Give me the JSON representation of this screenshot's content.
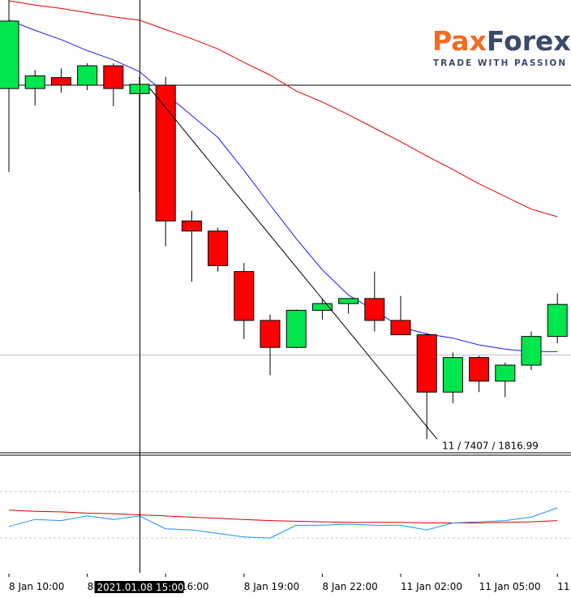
{
  "brand": {
    "name_part1": "Pa",
    "name_part2": "Forex",
    "tagline": "TRADE WITH PASSION",
    "colors": {
      "orange": "#f26b21",
      "navy": "#3b4a6b"
    }
  },
  "chart_data": {
    "type": "candlestick",
    "price_range": [
      1815.5,
      1869
    ],
    "bull_color": "#00e64d",
    "bear_color": "#ff0000",
    "candles": [
      {
        "o": 1858.5,
        "h": 1869.0,
        "l": 1848.6,
        "c": 1866.5
      },
      {
        "o": 1858.5,
        "h": 1860.7,
        "l": 1856.5,
        "c": 1860.0
      },
      {
        "o": 1859.8,
        "h": 1860.9,
        "l": 1858.0,
        "c": 1858.9
      },
      {
        "o": 1858.9,
        "h": 1861.5,
        "l": 1858.3,
        "c": 1861.2
      },
      {
        "o": 1861.2,
        "h": 1861.5,
        "l": 1856.4,
        "c": 1858.5
      },
      {
        "o": 1857.9,
        "h": 1859.9,
        "l": 1846.2,
        "c": 1859.0
      },
      {
        "o": 1858.9,
        "h": 1859.9,
        "l": 1839.8,
        "c": 1842.8
      },
      {
        "o": 1842.8,
        "h": 1844.0,
        "l": 1835.6,
        "c": 1841.6
      },
      {
        "o": 1841.6,
        "h": 1842.0,
        "l": 1836.8,
        "c": 1837.5
      },
      {
        "o": 1836.8,
        "h": 1837.8,
        "l": 1828.8,
        "c": 1831.0
      },
      {
        "o": 1831.0,
        "h": 1831.7,
        "l": 1824.5,
        "c": 1827.8
      },
      {
        "o": 1827.8,
        "h": 1832.3,
        "l": 1827.7,
        "c": 1832.2
      },
      {
        "o": 1832.2,
        "h": 1833.6,
        "l": 1831.1,
        "c": 1833.0
      },
      {
        "o": 1833.0,
        "h": 1833.6,
        "l": 1831.8,
        "c": 1833.6
      },
      {
        "o": 1833.6,
        "h": 1836.8,
        "l": 1829.7,
        "c": 1831.0
      },
      {
        "o": 1831.0,
        "h": 1833.9,
        "l": 1829.9,
        "c": 1829.3
      },
      {
        "o": 1829.3,
        "h": 1829.5,
        "l": 1816.9,
        "c": 1822.5
      },
      {
        "o": 1822.5,
        "h": 1827.2,
        "l": 1821.2,
        "c": 1826.6
      },
      {
        "o": 1826.6,
        "h": 1826.8,
        "l": 1822.5,
        "c": 1823.8
      },
      {
        "o": 1823.8,
        "h": 1826.0,
        "l": 1821.9,
        "c": 1825.7
      },
      {
        "o": 1825.7,
        "h": 1829.7,
        "l": 1825.1,
        "c": 1829.1
      },
      {
        "o": 1829.1,
        "h": 1834.2,
        "l": 1828.3,
        "c": 1832.9
      }
    ],
    "ma_fast": [
      1866.6,
      1865.4,
      1864.3,
      1863.0,
      1861.9,
      1860.5,
      1857.9,
      1855.3,
      1852.7,
      1848.8,
      1844.7,
      1840.7,
      1837.0,
      1834.0,
      1832.2,
      1830.2,
      1829.4,
      1828.9,
      1828.1,
      1827.6,
      1827.3,
      1827.3
    ],
    "ma_slow": [
      1868.9,
      1868.4,
      1868.0,
      1867.5,
      1867.0,
      1866.6,
      1865.5,
      1864.4,
      1863.2,
      1861.6,
      1860.1,
      1858.2,
      1856.9,
      1855.4,
      1853.8,
      1852.2,
      1850.5,
      1848.9,
      1847.2,
      1845.7,
      1844.2,
      1843.3
    ],
    "horizontal_line": 1858.9,
    "horizontal_line_light": 1826.9,
    "crosshair_index": 5,
    "trendline": {
      "from": {
        "i": 5.4,
        "v": 1858.5
      },
      "to": {
        "i": 16.4,
        "v": 1816.9
      }
    },
    "trendline_label": "11 / 7407 / 1816.99",
    "x_labels": [
      "8 Jan 10:00",
      "8",
      "an 16:00",
      "8 Jan 19:00",
      "8 Jan 22:00",
      "11 Jan 02:00",
      "11 Jan 05:00",
      "11 J"
    ],
    "x_label_index": [
      0,
      3,
      6,
      9,
      12,
      15,
      18,
      21
    ],
    "crosshair_label": "2021.01.08 15:00",
    "indicator": {
      "range": [
        0,
        100
      ],
      "levels": [
        70,
        30
      ],
      "red": [
        54,
        53,
        52.5,
        51.5,
        51,
        50,
        49,
        48,
        47,
        46,
        45,
        44.5,
        44,
        43.5,
        43.5,
        43.5,
        43,
        43,
        43,
        43.5,
        44,
        45
      ],
      "blue": [
        40,
        46,
        45,
        49,
        46,
        49,
        38,
        37,
        34,
        31,
        30,
        41,
        41,
        42,
        41,
        41,
        37,
        43,
        44,
        45,
        48,
        56
      ]
    }
  }
}
